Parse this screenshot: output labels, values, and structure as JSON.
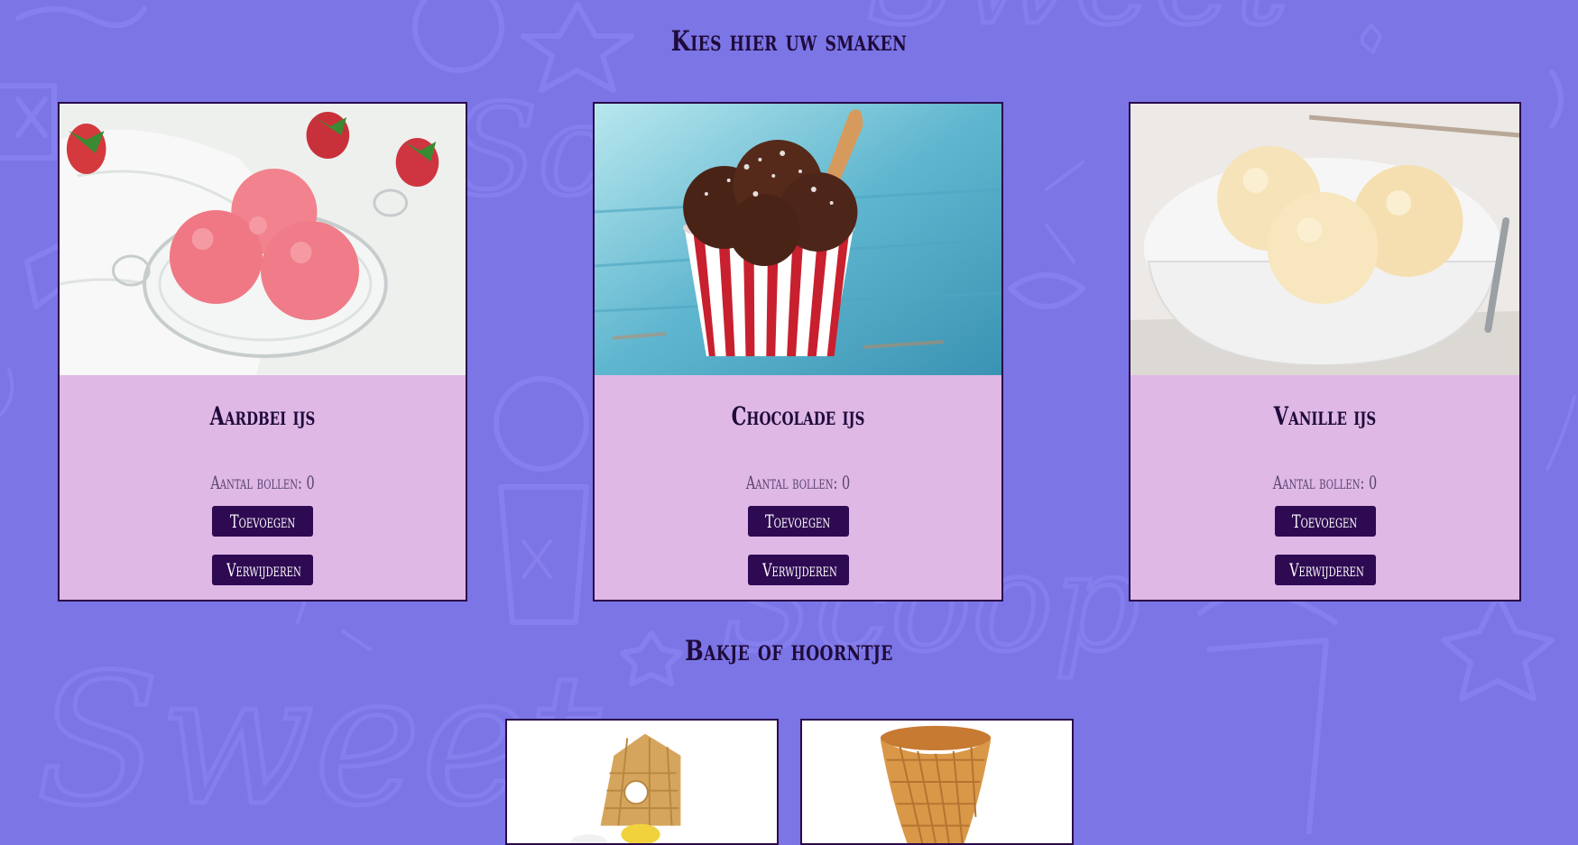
{
  "page": {
    "flavors_title": "Kies hier uw smaken",
    "containers_title": "Bakje of hoorntje"
  },
  "flavors": [
    {
      "name": "Aardbei ijs",
      "count_text": "Aantal bollen: 0",
      "add_label": "Toevoegen",
      "remove_label": "Verwijderen"
    },
    {
      "name": "Chocolade ijs",
      "count_text": "Aantal bollen: 0",
      "add_label": "Toevoegen",
      "remove_label": "Verwijderen"
    },
    {
      "name": "Vanille ijs",
      "count_text": "Aantal bollen: 0",
      "add_label": "Toevoegen",
      "remove_label": "Verwijderen"
    }
  ],
  "containers": [
    {
      "icon": "ice-cream-cup-image"
    },
    {
      "icon": "waffle-cone-image"
    }
  ],
  "colors": {
    "background": "#7b75e6",
    "card": "#dfb8e6",
    "button": "#2e0a52",
    "text": "#1f0a3a"
  }
}
